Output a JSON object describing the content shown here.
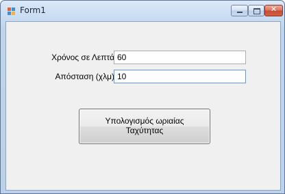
{
  "window": {
    "title": "Form1",
    "icon": "windows-forms-app-icon"
  },
  "caption_buttons": {
    "minimize_icon": "minimize-icon",
    "maximize_icon": "maximize-icon",
    "close_icon": "close-icon",
    "close_glyph": "✕",
    "close_color": "#c74a33"
  },
  "form": {
    "time_label": "Χρόνος σε Λεπτά",
    "time_value": "60",
    "distance_label": "Απόσταση (χλμ)",
    "distance_value": "10",
    "calculate_button_line1": "Υπολογισμός ωριαίας",
    "calculate_button_line2": "Ταχύτητας"
  }
}
